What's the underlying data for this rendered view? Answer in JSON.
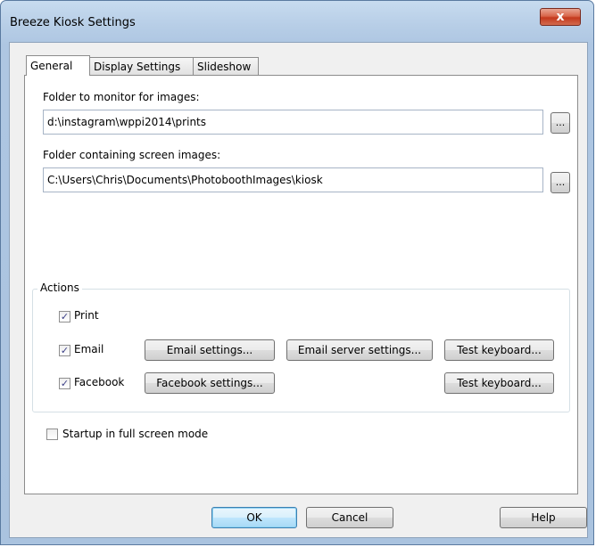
{
  "window": {
    "title": "Breeze Kiosk Settings",
    "close_glyph": "x"
  },
  "tabs": [
    {
      "label": "General",
      "active": true
    },
    {
      "label": "Display Settings",
      "active": false
    },
    {
      "label": "Slideshow",
      "active": false
    }
  ],
  "general": {
    "monitor_folder_label": "Folder to monitor for images:",
    "monitor_folder_value": "d:\\instagram\\wppi2014\\prints",
    "screen_folder_label": "Folder containing screen images:",
    "screen_folder_value": "C:\\Users\\Chris\\Documents\\PhotoboothImages\\kiosk",
    "browse_label": "..."
  },
  "actions": {
    "group_label": "Actions",
    "print": {
      "label": "Print",
      "checked": true
    },
    "email": {
      "label": "Email",
      "checked": true
    },
    "facebook": {
      "label": "Facebook",
      "checked": true
    },
    "email_settings_label": "Email settings...",
    "email_server_settings_label": "Email server settings...",
    "test_keyboard_label": "Test keyboard...",
    "facebook_settings_label": "Facebook settings...",
    "check_glyph": "✓"
  },
  "startup": {
    "label": "Startup in full screen mode",
    "checked": false
  },
  "footer": {
    "ok_label": "OK",
    "cancel_label": "Cancel",
    "help_label": "Help"
  }
}
